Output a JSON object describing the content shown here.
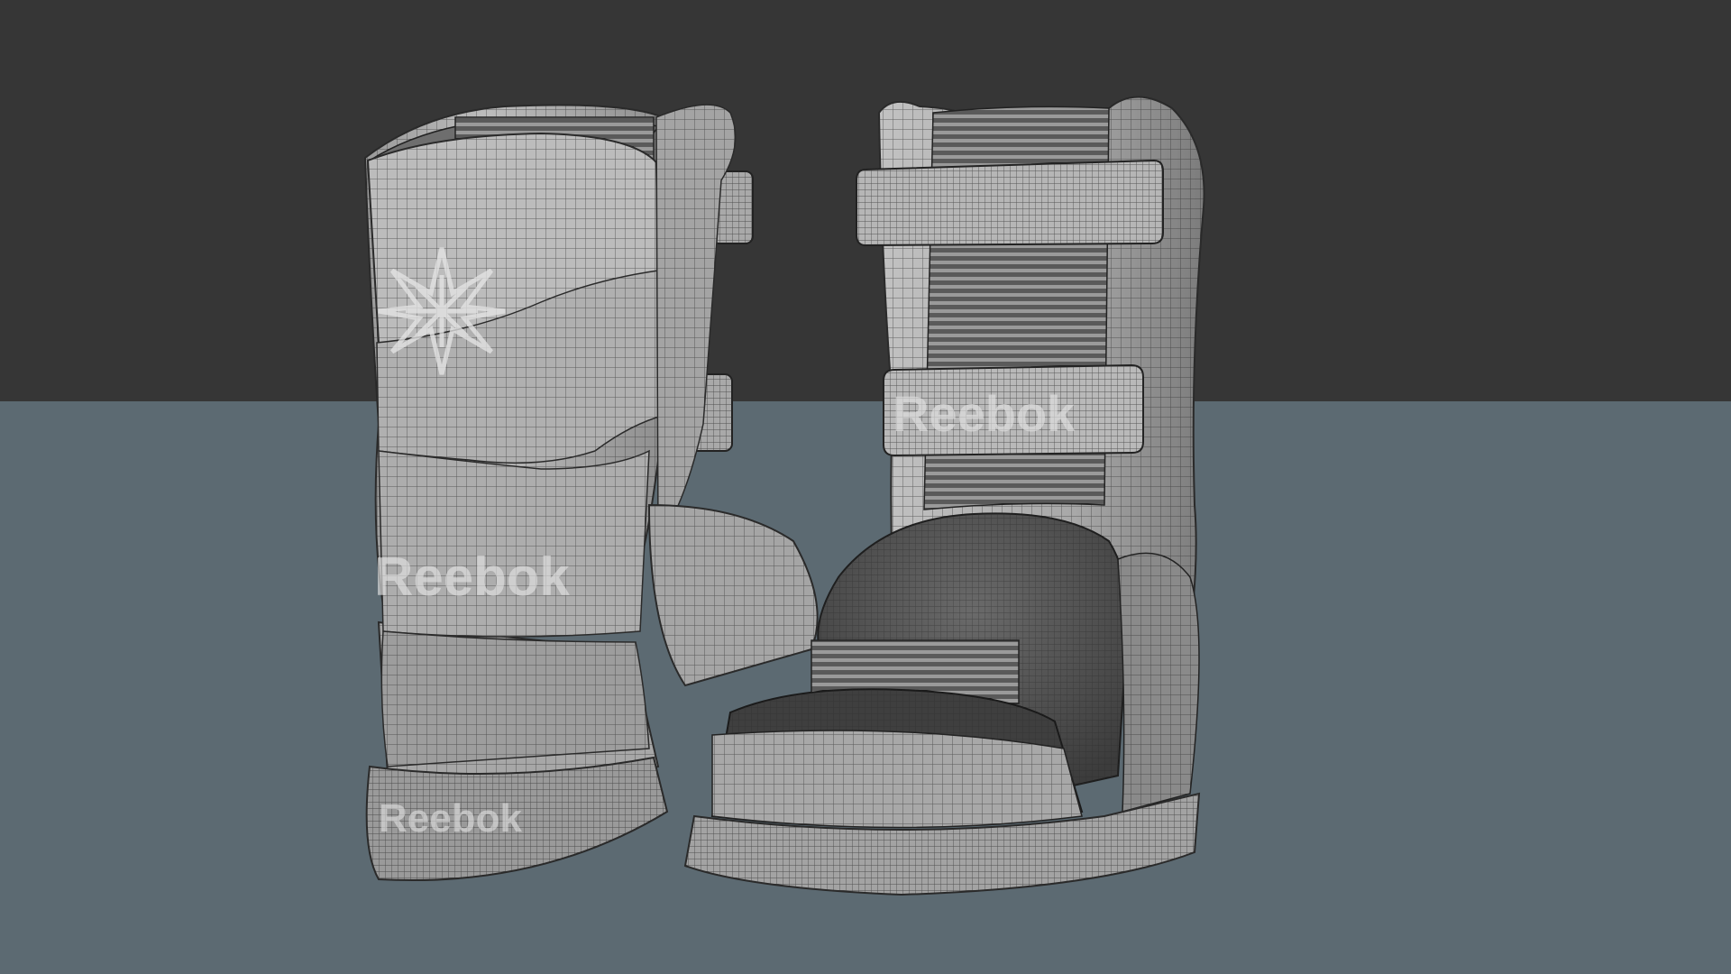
{
  "scene": {
    "background_color": "#363636",
    "floor_color": "#5c6a72",
    "mesh_color": "#b4b4b4",
    "wire_color": "#2e2e2e"
  },
  "left_boot": {
    "logo_text_calf": "Reebok",
    "logo_text_heel": "Reebok",
    "emblem": "reebok-starcrest-icon"
  },
  "right_boot": {
    "strap_logo_text": "Reebok"
  }
}
